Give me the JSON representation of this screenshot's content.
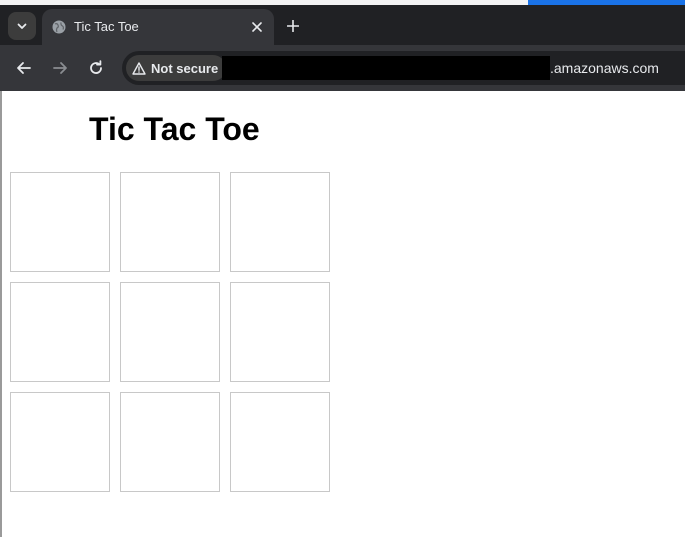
{
  "browser": {
    "tab": {
      "title": "Tic Tac Toe",
      "favicon": "globe-icon"
    },
    "tab_menu_icon": "chevron-down-icon",
    "close_icon": "close-icon",
    "new_tab_icon": "plus-icon",
    "nav": {
      "back_icon": "arrow-left-icon",
      "forward_icon": "arrow-right-icon",
      "reload_icon": "reload-icon"
    },
    "address_bar": {
      "security_label": "Not secure",
      "security_icon": "warning-triangle-icon",
      "url_domain": ".amazonaws.com"
    },
    "colors": {
      "tabstrip": "#202124",
      "toolbar": "#35363a",
      "accent": "#1a73e8"
    }
  },
  "page": {
    "title": "Tic Tac Toe",
    "board": {
      "cells": [
        "",
        "",
        "",
        "",
        "",
        "",
        "",
        "",
        ""
      ]
    }
  }
}
